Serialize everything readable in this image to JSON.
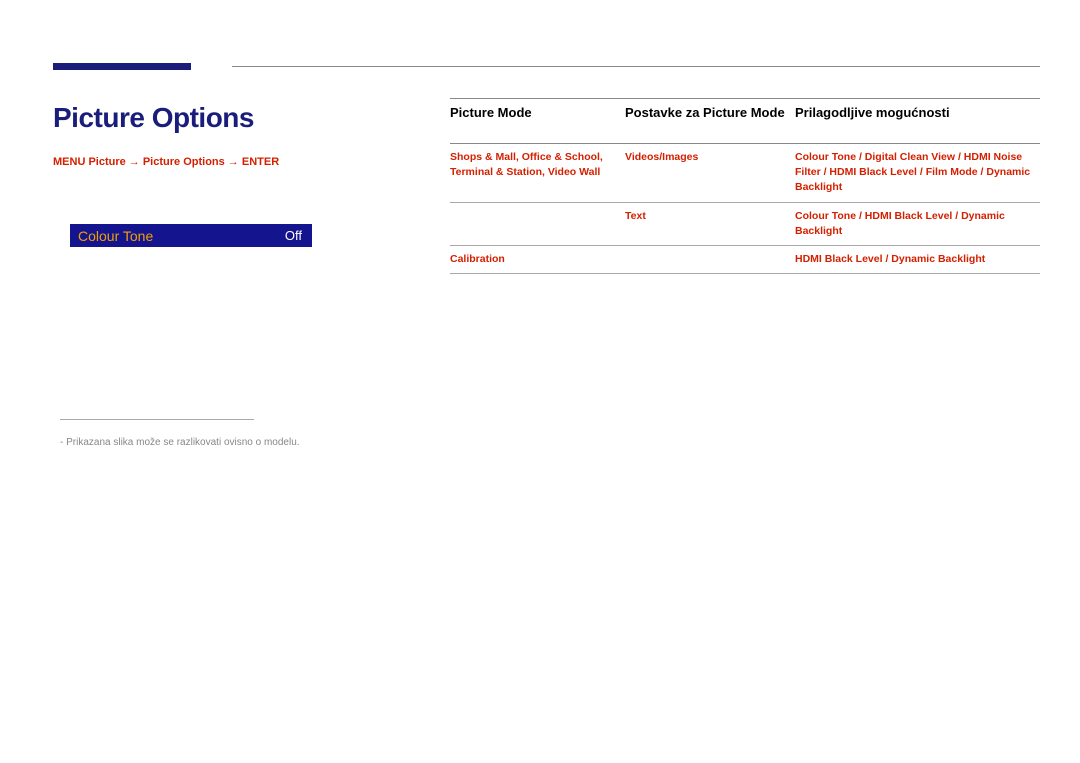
{
  "title": "Picture Options",
  "breadcrumb": "MENU  Picture  →  Picture Options  →  ENTER",
  "menu": {
    "label": "Colour Tone",
    "value": "Off"
  },
  "footnote": "Prikazana slika može se razlikovati ovisno o modelu.",
  "table": {
    "headers": [
      "Picture Mode",
      "Postavke za Picture Mode",
      "Prilagodljive mogućnosti"
    ],
    "rows": [
      {
        "mode": "Shops & Mall, Office & School, Terminal & Station, Video Wall",
        "setting": "Videos/Images",
        "opts": "Colour Tone / Digital Clean View / HDMI Noise Filter / HDMI Black Level / Film Mode / Dynamic Backlight"
      },
      {
        "mode": "",
        "setting": "Text",
        "opts": "Colour Tone / HDMI Black Level / Dynamic Backlight"
      },
      {
        "mode": "Calibration",
        "setting": "",
        "opts": "HDMI Black Level / Dynamic Backlight"
      }
    ]
  }
}
